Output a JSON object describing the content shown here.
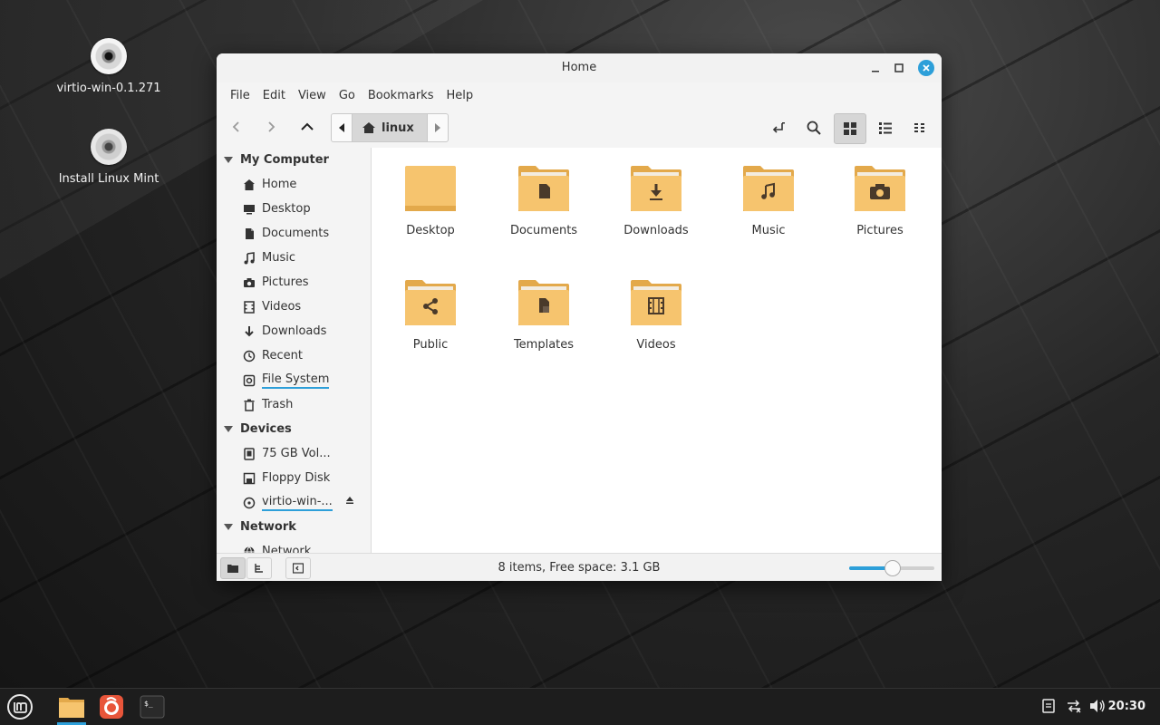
{
  "desktop": {
    "icons": [
      {
        "label": "virtio-win-0.1.271"
      },
      {
        "label": "Install Linux Mint"
      }
    ]
  },
  "window": {
    "title": "Home",
    "menu": [
      "File",
      "Edit",
      "View",
      "Go",
      "Bookmarks",
      "Help"
    ],
    "breadcrumb": {
      "current": "linux"
    },
    "sidebar": {
      "sections": [
        {
          "title": "My Computer",
          "items": [
            {
              "label": "Home",
              "icon": "home-icon"
            },
            {
              "label": "Desktop",
              "icon": "desktop-icon"
            },
            {
              "label": "Documents",
              "icon": "document-icon"
            },
            {
              "label": "Music",
              "icon": "music-icon"
            },
            {
              "label": "Pictures",
              "icon": "camera-icon"
            },
            {
              "label": "Videos",
              "icon": "film-icon"
            },
            {
              "label": "Downloads",
              "icon": "download-icon"
            },
            {
              "label": "Recent",
              "icon": "clock-icon"
            },
            {
              "label": "File System",
              "icon": "drive-icon"
            },
            {
              "label": "Trash",
              "icon": "trash-icon"
            }
          ]
        },
        {
          "title": "Devices",
          "items": [
            {
              "label": "75 GB Vol...",
              "icon": "harddisk-icon"
            },
            {
              "label": "Floppy Disk",
              "icon": "floppy-icon"
            },
            {
              "label": "virtio-win-...",
              "icon": "optical-disc-icon"
            }
          ]
        },
        {
          "title": "Network",
          "items": [
            {
              "label": "Network",
              "icon": "network-icon"
            }
          ]
        }
      ]
    },
    "files": [
      {
        "label": "Desktop",
        "icon": "folder-desktop-icon"
      },
      {
        "label": "Documents",
        "icon": "folder-documents-icon"
      },
      {
        "label": "Downloads",
        "icon": "folder-downloads-icon"
      },
      {
        "label": "Music",
        "icon": "folder-music-icon"
      },
      {
        "label": "Pictures",
        "icon": "folder-pictures-icon"
      },
      {
        "label": "Public",
        "icon": "folder-public-icon"
      },
      {
        "label": "Templates",
        "icon": "folder-templates-icon"
      },
      {
        "label": "Videos",
        "icon": "folder-videos-icon"
      }
    ],
    "status": "8 items, Free space: 3.1 GB",
    "zoom_level": 0.5
  },
  "taskbar": {
    "clock": "20:30"
  },
  "colors": {
    "accent": "#2d9fd9",
    "folder": "#f6c46e",
    "folder_dark": "#e3a94b"
  }
}
